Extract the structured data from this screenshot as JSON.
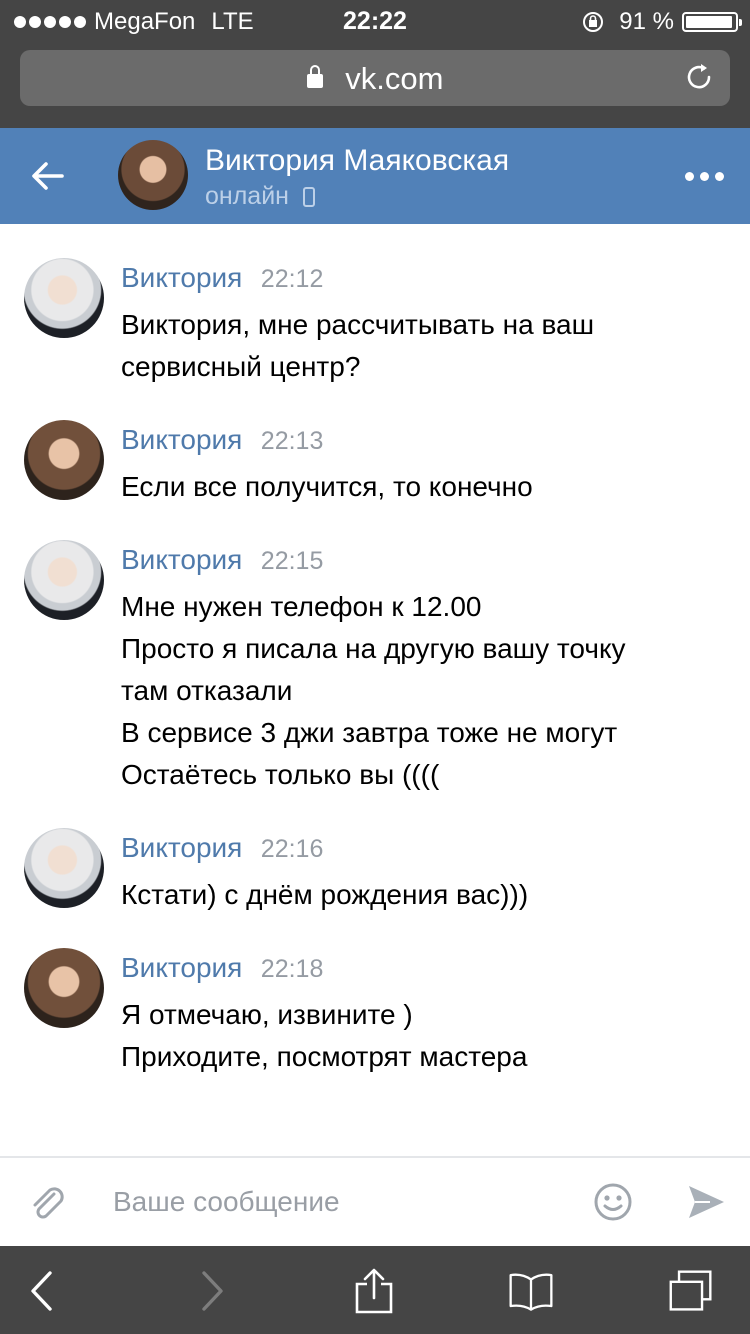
{
  "status_bar": {
    "carrier": "MegaFon",
    "network": "LTE",
    "time": "22:22",
    "battery": "91 %"
  },
  "browser": {
    "url": "vk.com"
  },
  "header": {
    "name": "Виктория Маяковская",
    "status": "онлайн"
  },
  "messages": [
    {
      "author": "Виктория",
      "time": "22:12",
      "avatar": "avatar-blonde",
      "lines": [
        "Виктория, мне рассчитывать на ваш",
        "сервисный центр?"
      ]
    },
    {
      "author": "Виктория",
      "time": "22:13",
      "avatar": "avatar-brunette",
      "lines": [
        "Если все получится, то конечно"
      ]
    },
    {
      "author": "Виктория",
      "time": "22:15",
      "avatar": "avatar-blonde",
      "lines": [
        "Мне нужен телефон к 12.00",
        "Просто я писала на другую вашу точку",
        "там отказали",
        "В сервисе 3 джи завтра тоже не могут",
        "Остаётесь только вы (((("
      ]
    },
    {
      "author": "Виктория",
      "time": "22:16",
      "avatar": "avatar-blonde",
      "lines": [
        "Кстати) с днём рождения вас)))"
      ]
    },
    {
      "author": "Виктория",
      "time": "22:18",
      "avatar": "avatar-brunette",
      "lines": [
        "Я отмечаю, извините )",
        "Приходите, посмотрят мастера"
      ]
    }
  ],
  "composer": {
    "placeholder": "Ваше сообщение"
  },
  "colors": {
    "header": "#5181b8",
    "author": "#4f7aab",
    "chrome": "#454545"
  },
  "icons": [
    "lock-icon",
    "reload-icon",
    "back-arrow-icon",
    "more-icon",
    "phone-icon",
    "attach-icon",
    "smile-icon",
    "send-icon",
    "safari-back-icon",
    "safari-forward-icon",
    "share-icon",
    "bookmarks-icon",
    "tabs-icon"
  ]
}
